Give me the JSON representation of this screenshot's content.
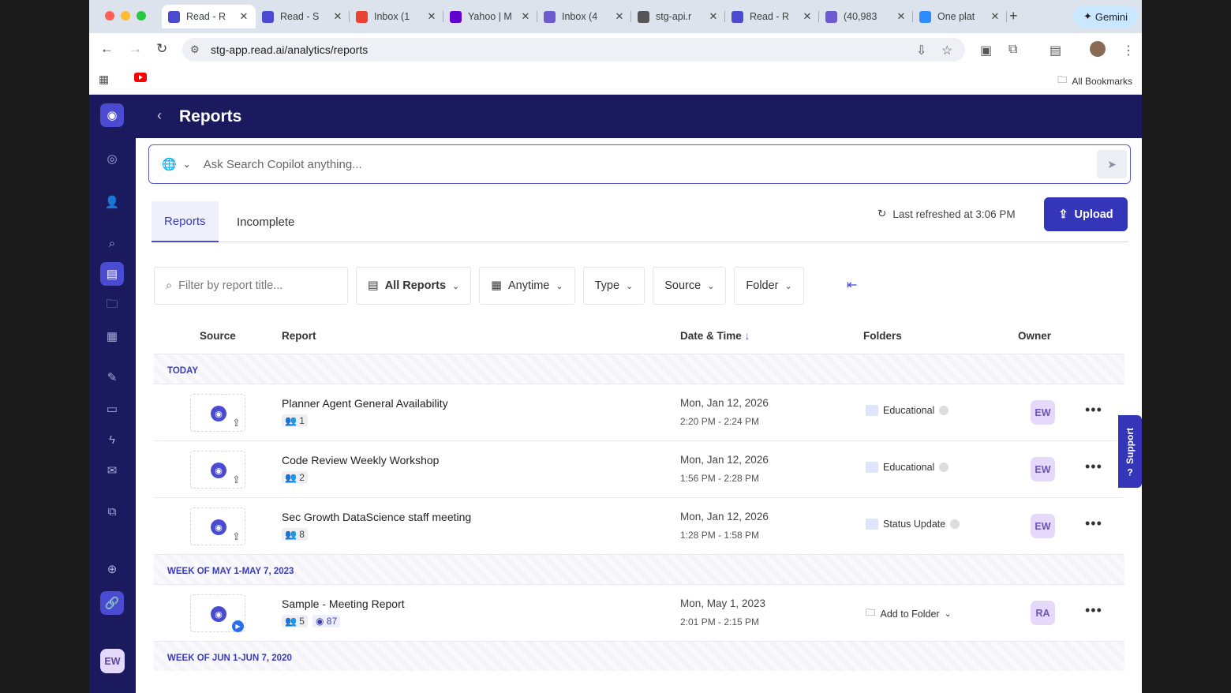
{
  "browser": {
    "tabs": [
      {
        "title": "Read - R",
        "fav_color": "#4a4bd1",
        "icon": "readai-icon"
      },
      {
        "title": "Read - S",
        "fav_color": "#4a4bd1",
        "icon": "readai-icon"
      },
      {
        "title": "Inbox (1",
        "fav_color": "#ea4335",
        "icon": "gmail-icon"
      },
      {
        "title": "Yahoo | M",
        "fav_color": "#6001d2",
        "icon": "yahoo-icon"
      },
      {
        "title": "Inbox (4",
        "fav_color": "#6f5bd0",
        "icon": "mail-icon"
      },
      {
        "title": "stg-api.r",
        "fav_color": "#555555",
        "icon": "globe-icon"
      },
      {
        "title": "Read - R",
        "fav_color": "#4a4bd1",
        "icon": "readai-icon"
      },
      {
        "title": "(40,983",
        "fav_color": "#6f5bd0",
        "icon": "mail-icon"
      },
      {
        "title": "One plat",
        "fav_color": "#2d8cff",
        "icon": "zoom-icon"
      }
    ],
    "gemini_label": "Gemini",
    "url": "stg-app.read.ai/analytics/reports",
    "all_bookmarks": "All Bookmarks"
  },
  "app": {
    "page_title": "Reports",
    "copilot_placeholder": "Ask Search Copilot anything...",
    "tabs": [
      "Reports",
      "Incomplete"
    ],
    "last_refreshed": "Last refreshed at 3:06 PM",
    "upload_label": "Upload",
    "filter_placeholder": "Filter by report title...",
    "filters": [
      "All Reports",
      "Anytime",
      "Type",
      "Source",
      "Folder"
    ],
    "columns": {
      "source": "Source",
      "report": "Report",
      "datetime": "Date & Time",
      "folders": "Folders",
      "owner": "Owner"
    },
    "support_label": "Support",
    "user_initials": "EW"
  },
  "groups": [
    {
      "label": "TODAY",
      "rows": [
        {
          "title": "Planner Agent General Availability",
          "participants": "1",
          "date": "Mon, Jan 12, 2026",
          "time": "2:20 PM - 2:24 PM",
          "folder": "Educational",
          "owner": "EW",
          "source": "upload"
        },
        {
          "title": "Code Review Weekly Workshop",
          "participants": "2",
          "date": "Mon, Jan 12, 2026",
          "time": "1:56 PM - 2:28 PM",
          "folder": "Educational",
          "owner": "EW",
          "source": "upload"
        },
        {
          "title": "Sec Growth DataScience staff meeting",
          "participants": "8",
          "date": "Mon, Jan 12, 2026",
          "time": "1:28 PM - 1:58 PM",
          "folder": "Status Update",
          "owner": "EW",
          "source": "upload"
        }
      ]
    },
    {
      "label": "WEEK OF MAY 1-MAY 7, 2023",
      "rows": [
        {
          "title": "Sample - Meeting Report",
          "participants": "5",
          "score": "87",
          "date": "Mon, May 1, 2023",
          "time": "2:01 PM - 2:15 PM",
          "folder": "Add to Folder",
          "owner": "RA",
          "source": "zoom"
        }
      ]
    },
    {
      "label": "WEEK OF JUN 1-JUN 7, 2020",
      "rows": []
    }
  ]
}
